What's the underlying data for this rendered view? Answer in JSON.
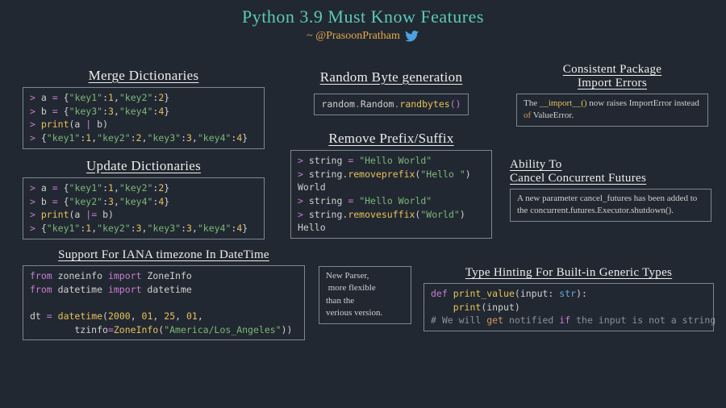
{
  "header": {
    "title": "Python 3.9 Must Know Features",
    "author": "~ @PrasoonPratham",
    "icon": "twitter-bird-icon"
  },
  "sections": {
    "merge": {
      "title": "Merge Dictionaries",
      "code": "> a = {\"key1\":1,\"key2\":2}\n> b = {\"key3\":3,\"key4\":4}\n> print(a | b)\n> {\"key1\":1,\"key2\":2,\"key3\":3,\"key4\":4}"
    },
    "update": {
      "title": "Update Dictionaries",
      "code": "> a = {\"key1\":1,\"key2\":2}\n> b = {\"key2\":3,\"key4\":4}\n> print(a |= b)\n> {\"key1\":1,\"key2\":3,\"key3\":3,\"key4\":4}"
    },
    "iana": {
      "title": "Support For IANA timezone In DateTime",
      "code": "from zoneinfo import ZoneInfo\nfrom datetime import datetime\n\ndt = datetime(2000, 01, 25, 01,\n        tzinfo=ZoneInfo(\"America/Los_Angeles\"))"
    },
    "randbytes": {
      "title": "Random Byte generation",
      "code": "random.Random.randbytes()"
    },
    "prefix": {
      "title": "Remove Prefix/Suffix",
      "code": "> string = \"Hello World\"\n> string.removeprefix(\"Hello \")\nWorld\n> string = \"Hello World\"\n> string.removesuffix(\"World\")\nHello"
    },
    "parser": {
      "text": "New Parser,\n more flexible\nthan the\nverious version."
    },
    "importerr": {
      "title": "Consistent Package\nImport Errors",
      "text": "The __import__() now raises ImportError instead of ValueError."
    },
    "cancel": {
      "title": "Ability To\nCancel Concurrent Futures",
      "text": "A new parameter cancel_futures has been added to the concurrent.futures.Executor.shutdown()."
    },
    "typehint": {
      "title": "Type Hinting For Built-in Generic Types",
      "code": "def print_value(input: str):\n    print(input)\n# We will get notified if the input is not a string"
    }
  }
}
